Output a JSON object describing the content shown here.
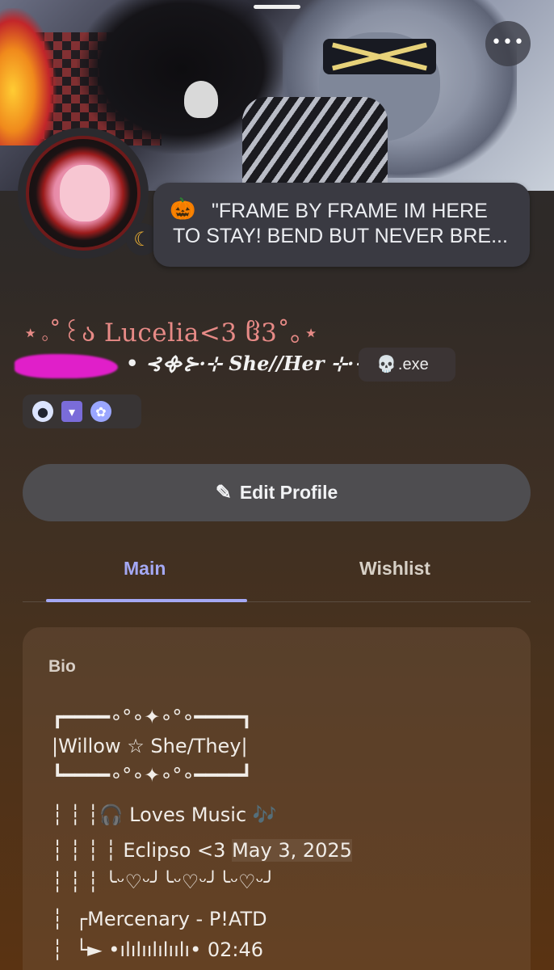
{
  "profile": {
    "status_message": "\"FRAME BY FRAME IM HERE\nTO STAY! BEND BUT NEVER BRE...",
    "status_emoji": "🎃",
    "display_name": "⋆｡˚꒰ა Luceliа<3 ჱ3˚｡⋆",
    "pronouns": "• ⊰᯽⊱·⊹ She//Her ⊹·⊰᯽⊱",
    "tag_icon": "💀",
    "tag_text": ".exe",
    "status_icon": "☾"
  },
  "actions": {
    "more_label": "•••",
    "edit_profile_label": "Edit Profile"
  },
  "tabs": {
    "main_label": "Main",
    "wishlist_label": "Wishlist"
  },
  "bio": {
    "label": "Bio",
    "lines": [
      "┏━━━━∘°∘✦∘°∘━━━━┓",
      "|Willow ☆ She/They|",
      "┗━━━━∘°∘✦∘°∘━━━━┛",
      "┆ ┆ ┆🎧 Loves Music 🎶",
      "┆ ┆ ┆ ┆ Eclipso <3 ",
      "┆ ┆ ┆ ╰ᵕ♡ᵕ╯╰ᵕ♡ᵕ╯╰ᵕ♡ᵕ╯",
      "┆  ┌Mercenary - P!ATD",
      "┆  └► •ılılıılılıılı• 02:46"
    ],
    "date_highlight": "May 3, 2025"
  },
  "colors": {
    "accent": "#a4a8f4",
    "display_name": "#e78a86",
    "redaction": "#e01fc9",
    "status_idle": "#f0b232"
  }
}
